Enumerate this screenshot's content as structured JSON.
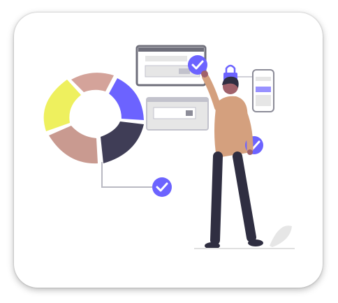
{
  "illustration": {
    "subject": "person-checking-data-dashboard",
    "colors": {
      "accent": "#6c63ff",
      "pie_yellow": "#eef05e",
      "pie_rose": "#d4a39a",
      "pie_blue": "#6c63ff",
      "pie_dark": "#3f3d56",
      "pie_rose_light": "#c99a90",
      "panel_bg": "#e6e6e6",
      "panel_border": "#c2c2cc",
      "shirt": "#d4a07e",
      "pants": "#2f2e41",
      "skin": "#a0616a"
    },
    "icons": [
      "check-icon",
      "lock-icon",
      "phone-icon",
      "plant-icon"
    ]
  }
}
